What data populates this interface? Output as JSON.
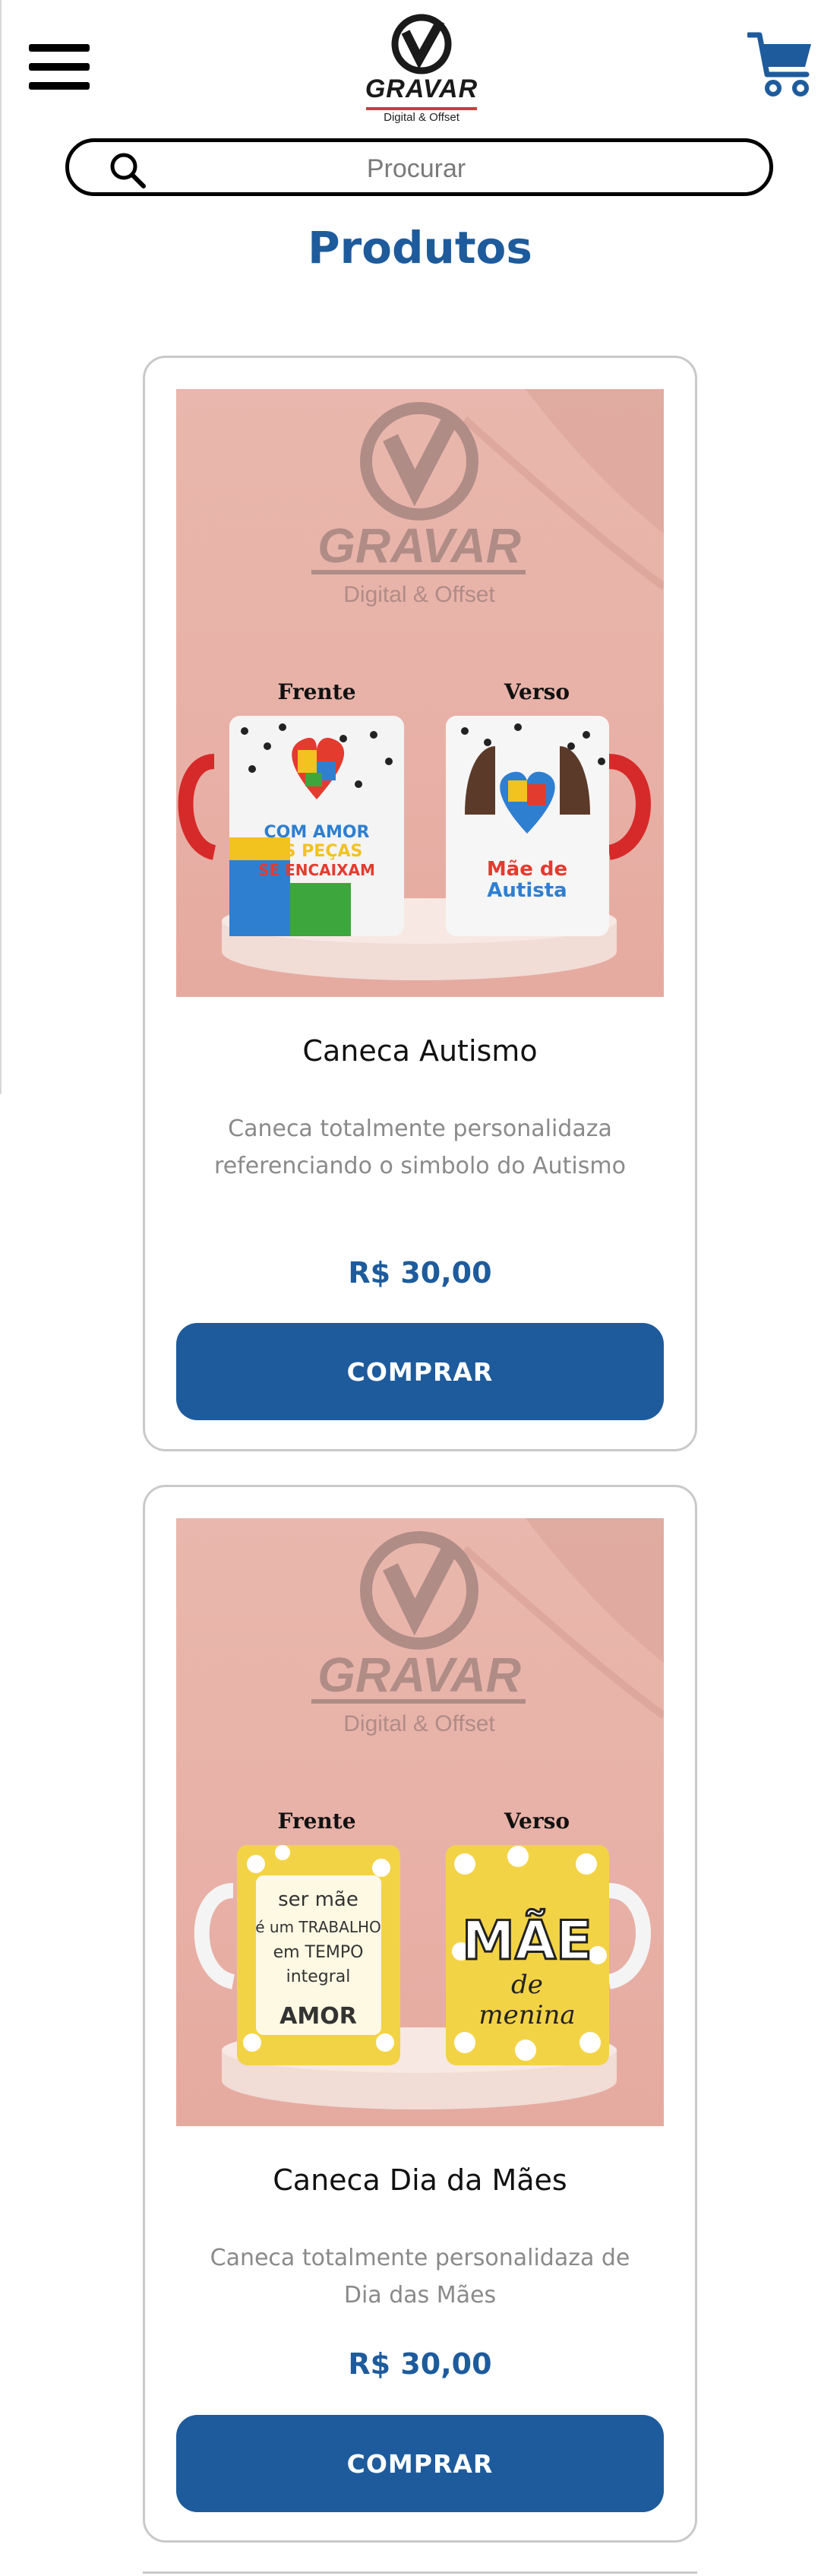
{
  "header": {
    "logo_text": "GRAVAR",
    "logo_subtitle": "Digital & Offset",
    "menu_icon": "hamburger-menu-icon",
    "cart_icon": "shopping-cart-icon",
    "cart_color": "#1e5b9c"
  },
  "search": {
    "placeholder": "Procurar",
    "icon": "search-icon"
  },
  "section_title": "Produtos",
  "products": [
    {
      "name": "Caneca Autismo",
      "description": "Caneca totalmente personalidaza referenciando o simbolo do Autismo",
      "price": "R$ 30,00",
      "button_label": "COMPRAR",
      "image": {
        "logo_text": "GRAVAR",
        "logo_subtitle": "Digital & Offset",
        "front_label": "Frente",
        "back_label": "Verso"
      }
    },
    {
      "name": "Caneca Dia da Mães",
      "description": "Caneca totalmente personalidaza de Dia das Mães",
      "price": "R$ 30,00",
      "button_label": "COMPRAR",
      "image": {
        "logo_text": "GRAVAR",
        "logo_subtitle": "Digital & Offset",
        "front_label": "Frente",
        "back_label": "Verso"
      }
    }
  ],
  "colors": {
    "primary": "#1e5b9c",
    "image_background": "#e9b7ad",
    "card_border": "#c9c9c9"
  }
}
